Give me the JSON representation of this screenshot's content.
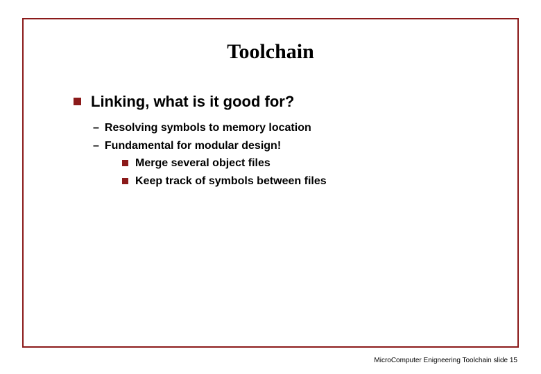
{
  "title": "Toolchain",
  "heading": "Linking, what is it good for?",
  "sub_points": [
    "Resolving symbols to memory location",
    "Fundamental for modular design!"
  ],
  "sub_sub_points": [
    "Merge several object files",
    "Keep track of symbols between files"
  ],
  "footer_text": "MicroComputer Enigneering Toolchain slide 15",
  "colors": {
    "accent": "#8b1a1a"
  }
}
